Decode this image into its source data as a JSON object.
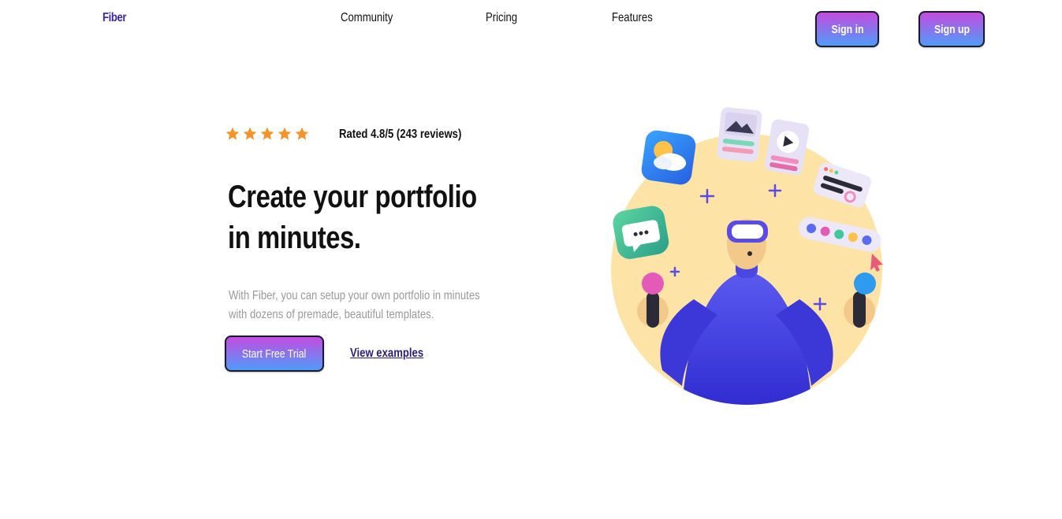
{
  "nav": {
    "logo": "Fiber",
    "links": [
      "Community",
      "Pricing",
      "Features"
    ],
    "sign_in": "Sign in",
    "sign_up": "Sign up"
  },
  "hero": {
    "stars": 5,
    "rating_text": "Rated 4.8/5 (243 reviews)",
    "headline_line1": "Create your portfolio",
    "headline_line2": "in minutes.",
    "description": "With Fiber, you can setup your own portfolio in minutes with dozens of premade, beautiful templates.",
    "cta_primary": "Start Free Trial",
    "cta_secondary": "View examples"
  },
  "colors": {
    "brand": "#3b2aa0",
    "star": "#f7932b",
    "button_gradient_top": "#c44be0",
    "button_gradient_bottom": "#4f9cf7",
    "muted_text": "#9a9a9a",
    "illustration_bg": "#fde4a6"
  },
  "icons": [
    "star-icon",
    "weather-app-icon",
    "image-card-icon",
    "video-card-icon",
    "chat-bubble-icon",
    "toggle-card-icon",
    "color-palette-icon",
    "cursor-icon",
    "plus-icon"
  ]
}
